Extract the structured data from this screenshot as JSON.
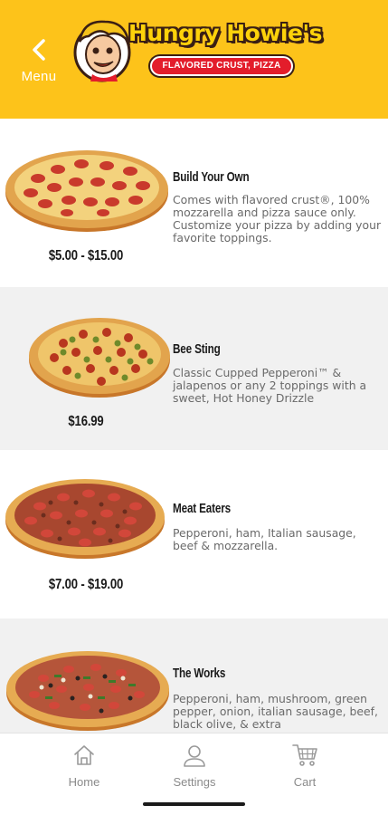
{
  "header": {
    "back_label": "Menu",
    "brand_name": "Hungry Howie's",
    "brand_tagline": "FLAVORED CRUST, PIZZA",
    "colors": {
      "header_bg": "#fdc31a",
      "logo_text": "#fdd20a",
      "tagline_bg": "#e31d2b"
    }
  },
  "menu": {
    "items": [
      {
        "name": "Build Your Own",
        "description": "Comes with flavored crust®, 100% mozzarella and pizza sauce only. Customize your pizza by adding your favorite toppings.",
        "price": "$5.00 - $15.00",
        "image": "pepperoni-pizza"
      },
      {
        "name": "Bee Sting",
        "description": "Classic Cupped Pepperoni™ & jalapenos or any 2 toppings with a sweet, Hot Honey Drizzle",
        "price": "$16.99",
        "image": "bee-sting-pizza"
      },
      {
        "name": "Meat Eaters",
        "description": "Pepperoni, ham, Italian sausage, beef & mozzarella.",
        "price": "$7.00 - $19.00",
        "image": "meat-eaters-pizza"
      },
      {
        "name": "The Works",
        "description": "Pepperoni, ham, mushroom, green pepper, onion, italian sausage, beef, black olive, & extra",
        "price": "",
        "image": "the-works-pizza"
      }
    ]
  },
  "tabbar": {
    "tabs": [
      {
        "label": "Home",
        "icon": "home-icon"
      },
      {
        "label": "Settings",
        "icon": "user-icon"
      },
      {
        "label": "Cart",
        "icon": "cart-icon"
      }
    ]
  }
}
